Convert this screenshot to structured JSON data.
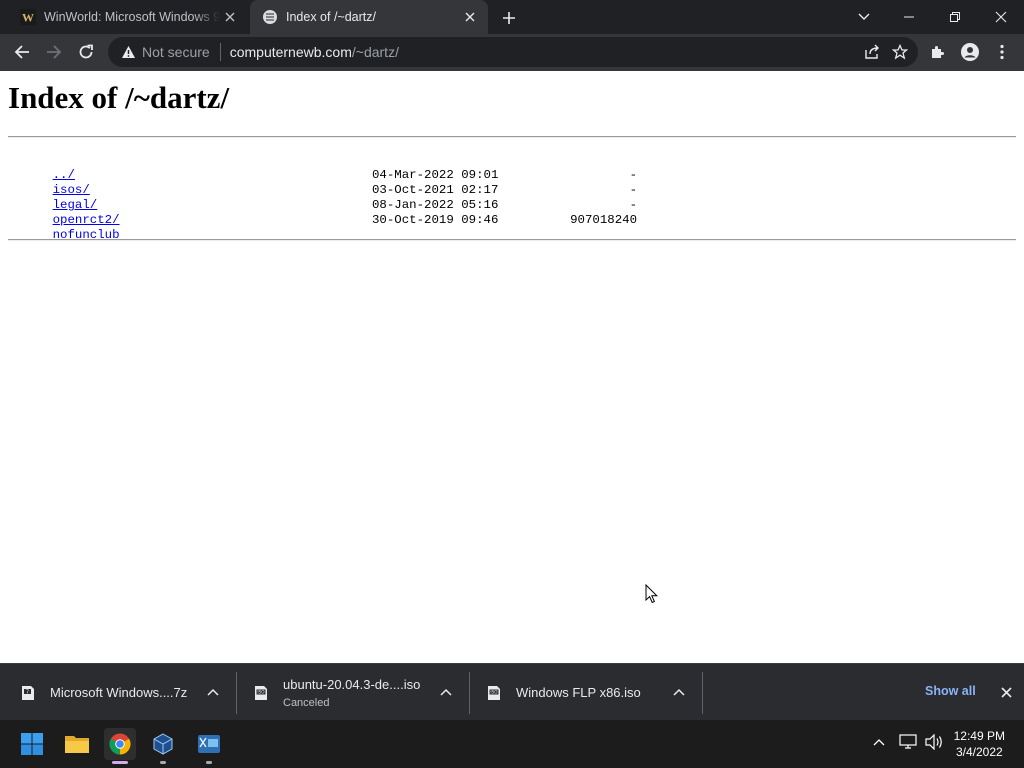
{
  "browser": {
    "tabs": [
      {
        "title": "WinWorld: Microsoft Windows 9",
        "favicon": "winworld-icon",
        "active": false
      },
      {
        "title": "Index of /~dartz/",
        "favicon": "server-icon",
        "active": true
      }
    ],
    "omnibox": {
      "security_label": "Not secure",
      "url_host": "computernewb.com",
      "url_path": "/~dartz/"
    }
  },
  "page": {
    "heading": "Index of /~dartz/",
    "entries": [
      {
        "name": "../",
        "date": "",
        "size": ""
      },
      {
        "name": "isos/",
        "date": "04-Mar-2022 09:01",
        "size": "-"
      },
      {
        "name": "legal/",
        "date": "03-Oct-2021 02:17",
        "size": "-"
      },
      {
        "name": "openrct2/",
        "date": "08-Jan-2022 05:16",
        "size": "-"
      },
      {
        "name": "nofunclub",
        "date": "30-Oct-2019 09:46",
        "size": "907018240"
      }
    ]
  },
  "downloads": {
    "items": [
      {
        "name": "Microsoft Windows....7z",
        "status": ""
      },
      {
        "name": "ubuntu-20.04.3-de....iso",
        "status": "Canceled"
      },
      {
        "name": "Windows FLP x86.iso",
        "status": ""
      }
    ],
    "show_all_label": "Show all"
  },
  "taskbar": {
    "apps": [
      "windows-start-icon",
      "file-explorer-icon",
      "chrome-icon",
      "virtualbox-icon",
      "vista-app-icon"
    ],
    "clock": {
      "time": "12:49 PM",
      "date": "3/4/2022"
    }
  },
  "colors": {
    "link": "#0000ee",
    "accent_blue": "#8ab4f8",
    "tab_active_bg": "#35363a",
    "frame_bg": "#202124"
  }
}
